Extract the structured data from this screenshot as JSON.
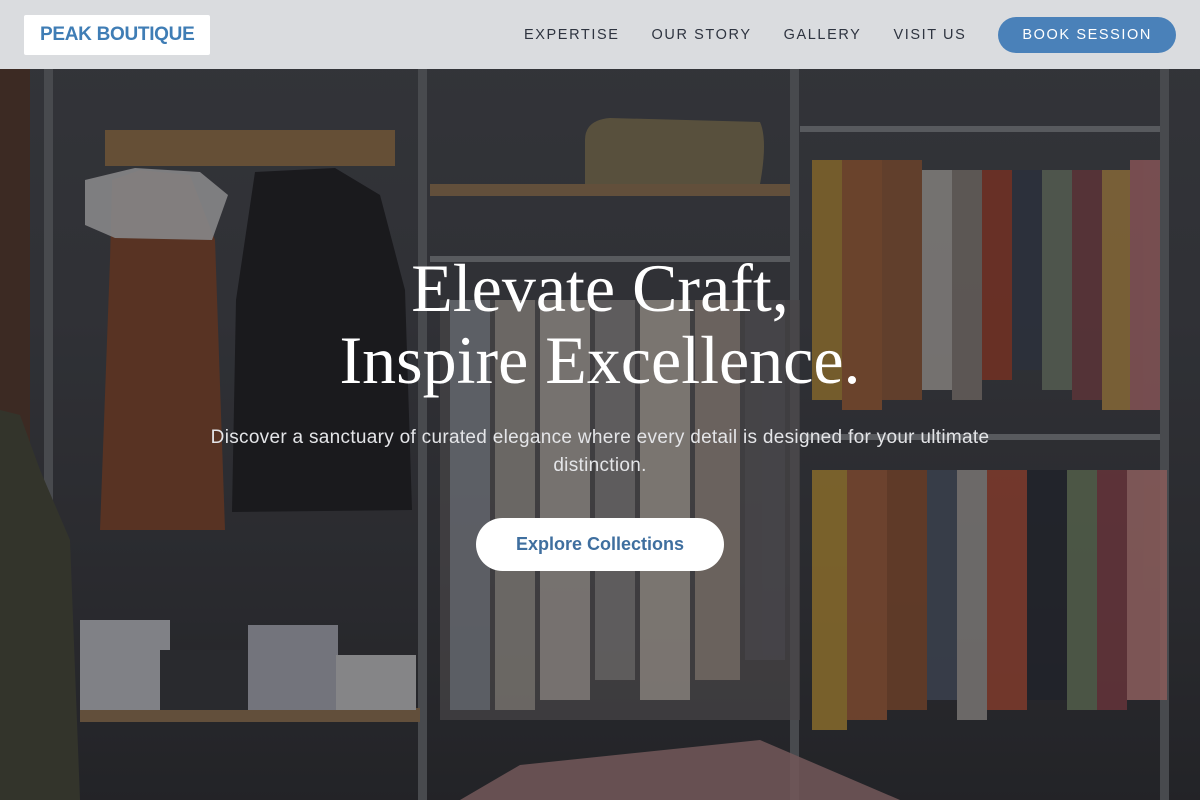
{
  "brand": {
    "logo_text": "PEAK BOUTIQUE",
    "accent_color": "#4a81b9"
  },
  "nav": {
    "links": [
      {
        "label": "EXPERTISE"
      },
      {
        "label": "OUR STORY"
      },
      {
        "label": "GALLERY"
      },
      {
        "label": "VISIT US"
      }
    ],
    "cta_label": "BOOK SESSION"
  },
  "hero": {
    "title_line1": "Elevate Craft,",
    "title_line2": "Inspire Excellence.",
    "subtitle": "Discover a sanctuary of curated elegance where every detail is designed for your ultimate distinction.",
    "cta_label": "Explore Collections",
    "background_description_icon": "boutique-interior-image"
  }
}
